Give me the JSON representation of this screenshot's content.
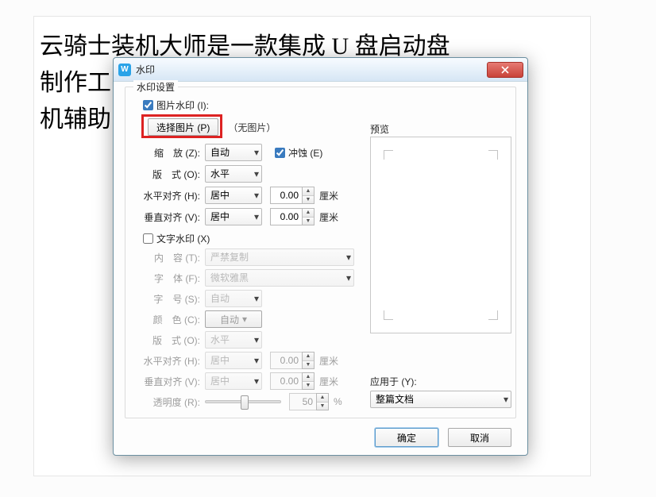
{
  "background_text_line1": "云骑士装机大师是一款集成 U 盘启动盘",
  "background_text_line2": "制作工                                装",
  "background_text_line3": "机辅助",
  "dialog": {
    "title": "水印",
    "group": "水印设置",
    "image_wm_label": "图片水印 (I):",
    "image_wm_checked": true,
    "select_image_label": "选择图片 (P)",
    "no_image_text": "（无图片）",
    "zoom_label": "缩　放 (Z):",
    "zoom_value": "自动",
    "erode_label": "冲蚀 (E)",
    "erode_checked": true,
    "layout_label": "版　式 (O):",
    "layout_value": "水平",
    "halign_label": "水平对齐 (H):",
    "halign_value": "居中",
    "halign_num": "0.00",
    "halign_unit": "厘米",
    "valign_label": "垂直对齐 (V):",
    "valign_value": "居中",
    "valign_num": "0.00",
    "valign_unit": "厘米",
    "text_wm_label": "文字水印 (X)",
    "text_wm_checked": false,
    "content_label": "内　容 (T):",
    "content_value": "严禁复制",
    "font_label": "字　体 (F):",
    "font_value": "微软雅黑",
    "size_label": "字　号 (S):",
    "size_value": "自动",
    "color_label": "颜　色 (C):",
    "color_value": "自动",
    "layout2_label": "版　式 (O):",
    "layout2_value": "水平",
    "halign2_label": "水平对齐 (H):",
    "halign2_value": "居中",
    "halign2_num": "0.00",
    "halign2_unit": "厘米",
    "valign2_label": "垂直对齐 (V):",
    "valign2_value": "居中",
    "valign2_num": "0.00",
    "valign2_unit": "厘米",
    "opacity_label": "透明度 (R):",
    "opacity_value": "50",
    "opacity_pct": "%",
    "preview_label": "预览",
    "apply_to_label": "应用于 (Y):",
    "apply_to_value": "整篇文档",
    "ok": "确定",
    "cancel": "取消"
  }
}
